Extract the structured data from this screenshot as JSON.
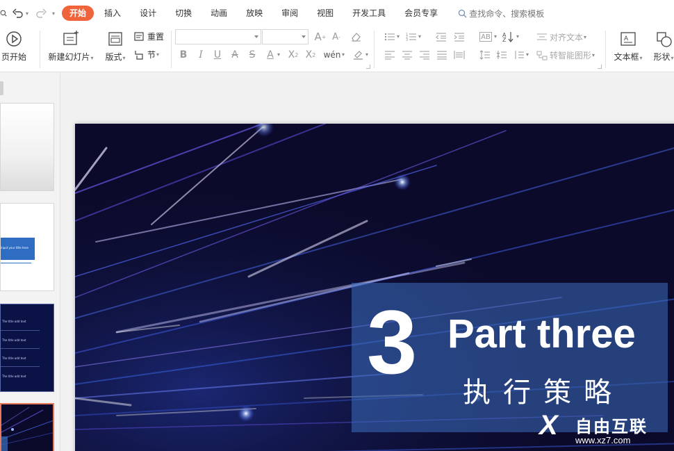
{
  "menubar": {
    "tabs": [
      {
        "label": "开始",
        "active": true
      },
      {
        "label": "插入"
      },
      {
        "label": "设计"
      },
      {
        "label": "切换"
      },
      {
        "label": "动画"
      },
      {
        "label": "放映"
      },
      {
        "label": "审阅"
      },
      {
        "label": "视图"
      },
      {
        "label": "开发工具"
      },
      {
        "label": "会员专享"
      }
    ],
    "search_placeholder": "查找命令、搜索模板",
    "accent_color": "#f0643c"
  },
  "ribbon": {
    "from_start": "页开始",
    "new_slide": "新建幻灯片",
    "layout": "版式",
    "reset": "重置",
    "section": "节",
    "font_name": "",
    "font_size": "",
    "align_text": "对齐文本",
    "convert_smartart": "转智能图形",
    "textbox": "文本框",
    "shape": "形状"
  },
  "slide": {
    "number": "3",
    "title": "Part three",
    "subtitle": "执行策略"
  },
  "thumbnails": [
    {
      "index": 1,
      "style": "blank"
    },
    {
      "index": 2,
      "style": "blue-banner",
      "caption": "input your title here"
    },
    {
      "index": 3,
      "style": "dark-list",
      "items": [
        "The title add text",
        "The title add text",
        "The title add text",
        "The title add text"
      ]
    },
    {
      "index": 4,
      "style": "dark-cover",
      "selected": true
    }
  ],
  "watermark": {
    "logo_letter": "X",
    "brand": "自由互联",
    "url": "www.xz7.com"
  }
}
